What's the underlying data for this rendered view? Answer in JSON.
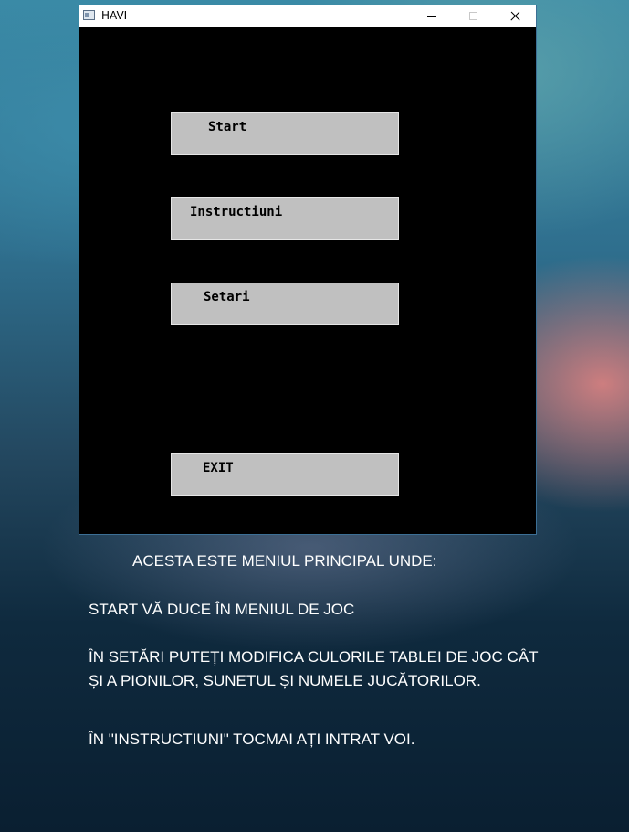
{
  "window": {
    "title": "HAVI",
    "controls": {
      "minimize": "minimize",
      "maximize": "maximize",
      "close": "close"
    }
  },
  "menu": {
    "start": "Start",
    "instructiuni": "Instructiuni",
    "setari": "Setari",
    "exit": "EXIT"
  },
  "caption": {
    "heading": "ACESTA ESTE MENIUL PRINCIPAL UNDE:",
    "line1": "START VĂ DUCE ÎN MENIUL DE JOC",
    "line2a": "ÎN SETĂRI PUTEȚI MODIFICA CULORILE TABLEI DE JOC CÂT",
    "line2b": "ȘI A PIONILOR, SUNETUL ȘI NUMELE JUCĂTORILOR.",
    "line3": "ÎN \"INSTRUCTIUNI\" TOCMAI AȚI INTRAT VOI."
  }
}
